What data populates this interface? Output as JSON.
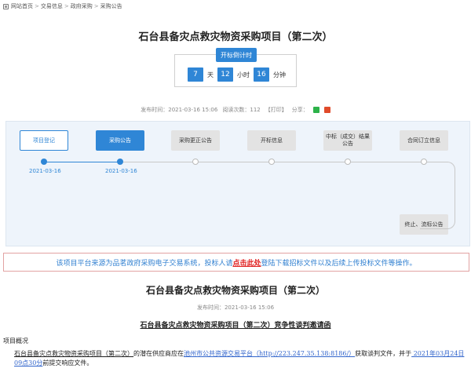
{
  "breadcrumb": {
    "items": [
      "网站首页",
      "交易信息",
      "政府采购",
      "采购公告"
    ],
    "separator": ">"
  },
  "page_title": "石台县备灾点救灾物资采购项目（第二次）",
  "countdown": {
    "label": "开标倒计时",
    "days": "7",
    "days_unit": "天",
    "hours": "12",
    "hours_unit": "小时",
    "minutes": "16",
    "minutes_unit": "分钟"
  },
  "meta": {
    "publish_time": "发布时间：2021-03-16 15:06",
    "views": "阅读次数：112",
    "print": "【打印】",
    "share": "分享："
  },
  "flow": {
    "steps": [
      {
        "label": "项目登记",
        "state": "done",
        "date": "2021-03-16"
      },
      {
        "label": "采购公告",
        "state": "current",
        "date": "2021-03-16"
      },
      {
        "label": "采购更正公告",
        "state": "pending"
      },
      {
        "label": "开标信息",
        "state": "pending"
      },
      {
        "label": "中标（成交）结果公告",
        "state": "pending"
      },
      {
        "label": "合同订立信息",
        "state": "pending"
      },
      {
        "label": "终止、流标公告",
        "state": "pending"
      }
    ]
  },
  "notice": {
    "before": "该项目平台来源为品茗政府采购电子交易系统，投标人请",
    "link": "点击此处",
    "after": "登陆下载招标文件以及后续上传投标文件等操作。"
  },
  "article": {
    "title": "石台县备灾点救灾物资采购项目（第二次）",
    "date": "发布时间：2021-03-16 15:06",
    "subtitle": "石台县备灾点救灾物资采购项目（第二次）竞争性谈判邀请函",
    "section": "项目概况",
    "para_1": "石台县备灾点救灾物资采购项目（第二次）",
    "para_2": "的潜在供应商应在",
    "para_3": "池州市公共资源交易平台（http://223.247.35.138:8186/）",
    "para_4": "获取谈判文件，并于",
    "para_5": " 2021年03月24日09点30分",
    "para_6": "前提交响应文件。"
  },
  "colors": {
    "primary": "#2f86d6",
    "link_red": "#e02020",
    "panel_bg": "#eef4fb"
  }
}
